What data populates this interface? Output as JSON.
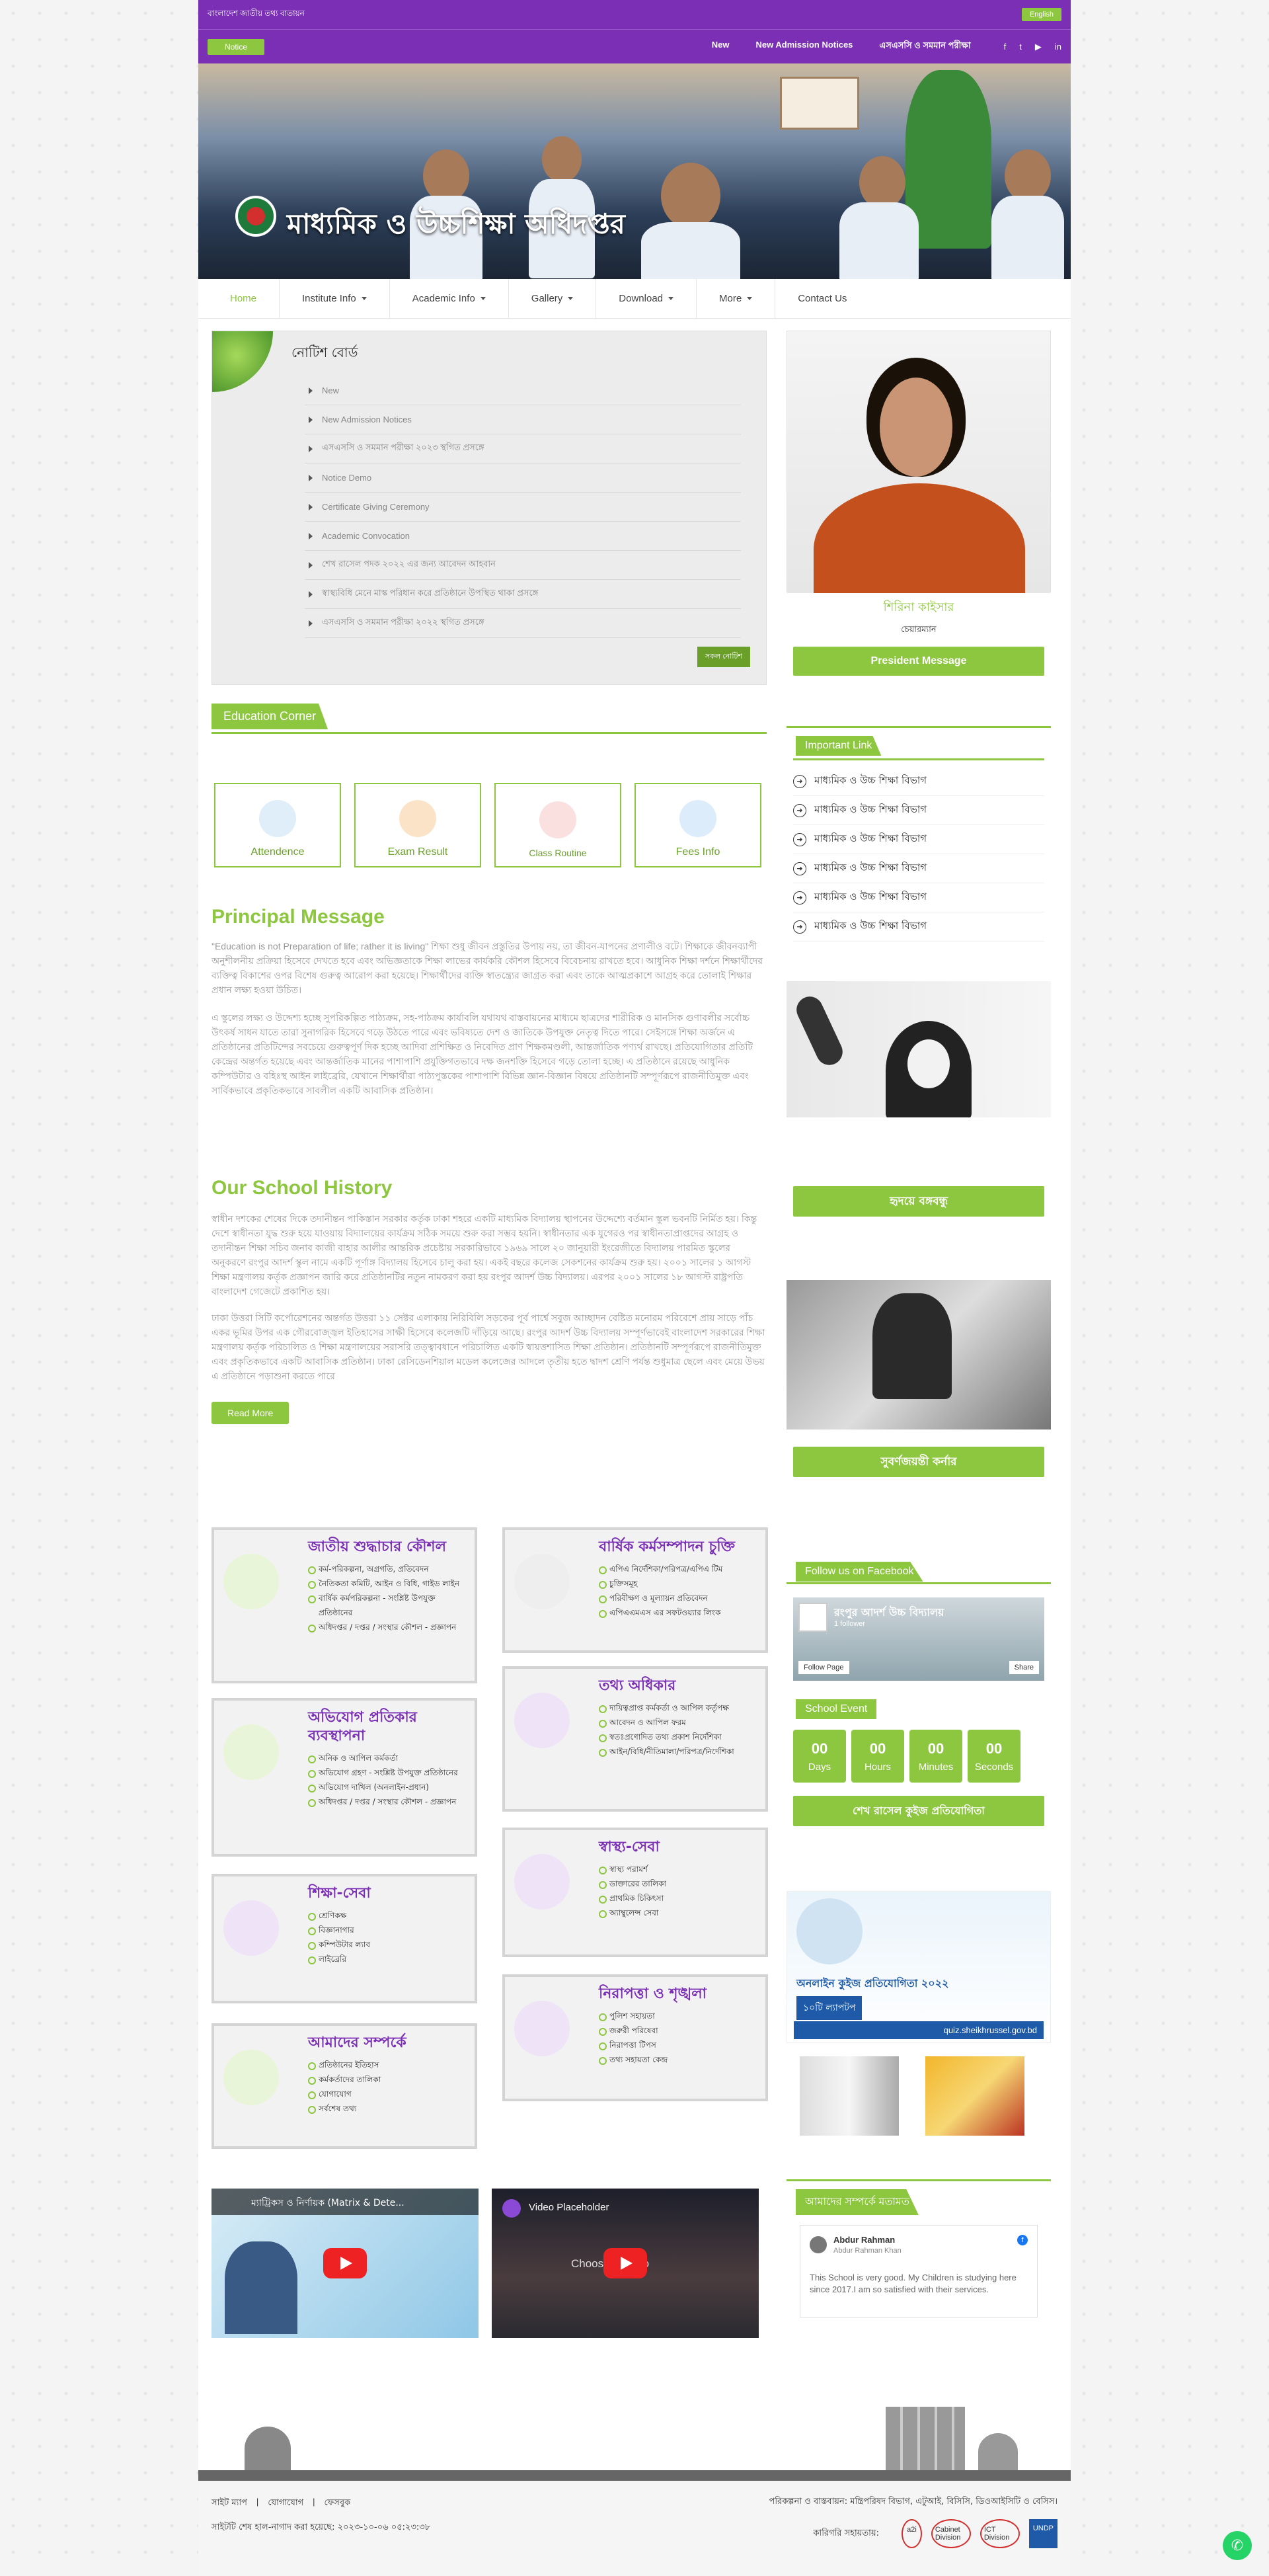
{
  "topbar": {
    "left_text": "বাংলাদেশ জাতীয় তথ্য বাতায়ন",
    "lang": "English"
  },
  "nav2": {
    "notice": "Notice",
    "links": [
      "New",
      "New Admission Notices",
      "এসএসসি ও সমমান পরীক্ষা"
    ]
  },
  "hero": {
    "title": "মাধ্যমিক ও উচ্চশিক্ষা অধিদপ্তর"
  },
  "menu": [
    "Home",
    "Institute Info",
    "Academic Info",
    "Gallery",
    "Download",
    "More",
    "Contact Us"
  ],
  "notice_board": {
    "title": "নোটিশ বোর্ড",
    "items": [
      "New",
      "New Admission Notices",
      "এসএসসি ও সমমান পরীক্ষা ২০২৩ স্থগিত প্রসঙ্গে",
      "Notice Demo",
      "Certificate Giving Ceremony",
      "Academic Convocation",
      "শেখ রাসেল পদক ২০২২ এর জন্য আবেদন আহবান",
      "স্বাস্থ্যবিধি মেনে মাস্ক পরিধান করে প্রতিষ্ঠানে উপস্থিত থাকা প্রসঙ্গে",
      "এসএসসি ও সমমান পরীক্ষা ২০২২ স্থগিত প্রসঙ্গে"
    ],
    "all_btn": "সকল নোটিশ"
  },
  "edu": {
    "title": "Education Corner",
    "cards": [
      "Attendence",
      "Exam Result",
      "Class Routine",
      "Fees Info"
    ]
  },
  "principal": {
    "title": "Principal Message",
    "p1": "\"Education is not Preparation of life; rather it is living\" শিক্ষা শুধু জীবন প্রস্তুতির উপায় নয়, তা জীবন-যাপনের প্রণালীও বটে। শিক্ষাকে জীবনব্যাপী অনুশীলনীয় প্রক্রিয়া হিসেবে দেখতে হবে এবং অভিজ্ঞতাকে শিক্ষা লাভের কার্যকরি কৌশল হিসেবে বিবেচনায় রাখতে হবে। আধুনিক শিক্ষা দর্শনে শিক্ষার্থীদের ব্যক্তিত্ব বিকাশের ওপর বিশেষ গুরুত্ব আরোপ করা হয়েছে। শিক্ষার্থীদের ব্যক্তি স্বাতন্ত্র্যের জাগ্রত করা এবং তাকে আত্মপ্রকাশে আগ্রহ করে তোলাই শিক্ষার প্রধান লক্ষ্য হওয়া উচিত।",
    "p2": "এ স্কুলের লক্ষ্য ও উদ্দেশ্য হচ্ছে সুপরিকল্পিত পাঠ্যক্রম, সহ-পাঠক্রম কার্যাবলি যথাযথ বাস্তবায়নের মাধ্যমে ছাত্রদের শারীরিক ও মানসিক গুণাবলীর সর্বোচ্চ উৎকর্ষ সাধন যাতে তারা সুনাগরিক হিসেবে গড়ে উঠতে পারে এবং ভবিষ্যতে দেশ ও জাতিকে উপযুক্ত নেতৃত্ব দিতে পারে। সেইসঙ্গে শিক্ষা অর্জনে এ প্রতিষ্ঠানের প্রতিটিন্দের সবচেয়ে গুরুত্বপূর্ণ দিক হচ্ছে আদিবা প্রশিক্ষিত ও নিবেদিত প্রাণ শিক্ষকমণ্ডলী, আন্তর্জাতিক পণ্যর্থ রাখছে। প্রতিযোগিতার প্রতিটি কেন্দ্রের অন্তর্গত হয়েছে এবং আন্তর্জাতিক মানের পাশাপাশি প্রযুক্তিগতভাবে দক্ষ জনশক্তি হিসেবে গড়ে তোলা হচ্ছে। এ প্রতিষ্ঠানে রয়েছে আধুনিক কম্পিউটার ও বহিঃস্থ আইন লাইব্রেরি, যেখানে শিক্ষার্থীরা পাঠ্যপুস্তকের পাশাপাশি বিভিন্ন জ্ঞান-বিজ্ঞান বিষয়ে প্রতিষ্ঠানটি সম্পূর্ণরূপে রাজনীতিমুক্ত এবং সার্বিকভাবে প্রকৃতিকভাবে সাবলীল একটি আবাসিক প্রতিষ্ঠান।"
  },
  "history": {
    "title": "Our School History",
    "p1": "স্বাধীন দশকের শেষের দিকে তদানীন্তন পাকিস্তান সরকার কর্তৃক ঢাকা শহরে একটি মাধ্যমিক বিদ্যালয় স্থাপনের উদ্দেশ্যে বর্তমান স্কুল ভবনটি নির্মিত হয়। কিন্তু দেশে স্বাধীনতা যুদ্ধ শুরু হয়ে যাওয়ায় বিদ্যালয়ের কার্যক্রম সঠিক সময়ে শুরু করা সম্ভব হয়নি। স্বাধীনতার এক যুগেরও পর স্বাধীনতাপ্রাপ্তদের আগ্রহ ও তদানীন্তন শিক্ষা সচিব জনাব কাজী বাহার আলীর আন্তরিক প্রচেষ্টায় সরকারিভাবে ১৯৬৯ সালে ২০ জানুয়ারী ইংরেজীতে বিদ্যালয় পারমিত স্কুলের অনুকরণে রংপুর আদর্শ স্কুল নামে একটি পূর্ণাঙ্গ বিদ্যালয় হিসেবে চালু করা হয়। একই বছরে কলেজ সেকশনের কার্যক্রম শুরু হয়। ২০০১ সালের ১ আগস্ট শিক্ষা মন্ত্রণালয় কর্তৃক প্রজ্ঞাপন জারি করে প্রতিষ্ঠানটির নতুন নামকরণ করা হয় রংপুর আদর্শ উচ্চ বিদ্যালয়। এরপর ২০০১ সালের ১৮ আগস্ট রাষ্ট্রপতি বাংলাদেশ গেজেটে প্রকাশিত হয়।",
    "p2": "ঢাকা উত্তরা সিটি কর্পোরেশনের অন্তর্গত উত্তরা ১১ সেক্টর এলাকায় নিরিবিলি সড়কের পূর্ব পার্শ্বে সবুজ আচ্ছাদন বেষ্টিত মনোরম পরিবেশে প্রায় সাড়ে পাঁচ একর ভূমির উপর এক গৌরবোজ্জ্বল ইতিহাসের সাক্ষী হিসেবে কলেজটি দাঁড়িয়ে আছে। রংপুর আদর্শ উচ্চ বিদ্যালয় সম্পূর্ণভাবেই বাংলাদেশ সরকারের শিক্ষা মন্ত্রণালয় কর্তৃক পরিচালিত ও শিক্ষা মন্ত্রণালয়ের সরাসরি তত্ত্বাবধানে পরিচালিত একটি স্বায়ত্তশাসিত শিক্ষা প্রতিষ্ঠান। প্রতিষ্ঠানটি সম্পূর্ণরূপে রাজনীতিমুক্ত এবং প্রকৃতিকভাবে একটি আবাসিক প্রতিষ্ঠান। ঢাকা রেসিডেনশিয়াল মডেল কলেজের আদলে তৃতীয় হতে দ্বাদশ শ্রেণি পর্যন্ত শুধুমাত্র ছেলে এবং মেয়ে উভয় এ প্রতিষ্ঠানে পড়াশুনা করতে পারে",
    "btn": "Read More"
  },
  "services": [
    {
      "title": "জাতীয় শুদ্ধাচার কৌশল",
      "items": [
        "কর্ম-পরিকল্পনা, অগ্রগতি, প্রতিবেদন",
        "নৈতিকতা কমিটি, আইন ও বিধি, গাইড লাইন",
        "বার্ষিক কর্মপরিকল্পনা - সংশ্লিষ্ট উপযুক্ত প্রতিষ্ঠানের",
        "অধিদপ্তর / দপ্তর / সংস্থার কৌশল - প্রজ্ঞাপন"
      ]
    },
    {
      "title": "বার্ষিক কর্মসম্পাদন চুক্তি",
      "items": [
        "এপিএ নির্দেশিকা/পরিপত্র/এপিএ টিম",
        "চুক্তিসমূহ",
        "পরিবীক্ষণ ও মূল্যায়ন প্রতিবেদন",
        "এপিএএমএস এর সফটওয়্যার লিংক"
      ]
    },
    {
      "title": "অভিযোগ প্রতিকার ব্যবস্থাপনা",
      "items": [
        "অনিক ও আপিল কর্মকর্তা",
        "অভিযোগ গ্রহণ - সংশ্লিষ্ট উপযুক্ত প্রতিষ্ঠানের",
        "অভিযোগ দাখিল (অনলাইন-প্রধান)",
        "অধিদপ্তর / দপ্তর / সংস্থার কৌশল - প্রজ্ঞাপন"
      ]
    },
    {
      "title": "তথ্য অধিকার",
      "items": [
        "দায়িত্বপ্রাপ্ত কর্মকর্তা ও আপিল কর্তৃপক্ষ",
        "আবেদন ও আপিল ফরম",
        "স্বতঃপ্রণোদিত তথ্য প্রকাশ নির্দেশিকা",
        "আইন/বিধি/নীতিমালা/পরিপত্র/নির্দেশিকা"
      ]
    },
    {
      "title": "শিক্ষা-সেবা",
      "items": [
        "শ্রেণিকক্ষ",
        "বিজ্ঞানাগার",
        "কম্পিউটার ল্যাব",
        "লাইব্রেরি"
      ]
    },
    {
      "title": "স্বাস্থ্য-সেবা",
      "items": [
        "স্বাস্থ্য পরামর্শ",
        "ডাক্তারের তালিকা",
        "প্রাথমিক চিকিৎসা",
        "অ্যাম্বুলেন্স সেবা"
      ]
    },
    {
      "title": "আমাদের সম্পর্কে",
      "items": [
        "প্রতিষ্ঠানের ইতিহাস",
        "কর্মকর্তাদের তালিকা",
        "যোগাযোগ",
        "সর্বশেষ তথ্য"
      ]
    },
    {
      "title": "নিরাপত্তা ও শৃঙ্খলা",
      "items": [
        "পুলিশ সহায়তা",
        "জরুরী পরিষেবা",
        "নিরাপত্তা টিপস",
        "তথ্য সহায়তা কেন্দ্র"
      ]
    }
  ],
  "videos": [
    {
      "title": "ম্যাট্রিকস ও নির্ণায়ক (Matrix & Dete..."
    },
    {
      "title": "Video Placeholder",
      "sub": "Choose a video"
    }
  ],
  "president": {
    "name": "শিরিনা কাইসার",
    "role": "চেয়ারম্যান",
    "btn": "President Message"
  },
  "important": {
    "title": "Important Link",
    "items": [
      "মাধ্যমিক ও উচ্চ শিক্ষা বিভাগ",
      "মাধ্যমিক ও উচ্চ শিক্ষা বিভাগ",
      "মাধ্যমিক ও উচ্চ শিক্ষা বিভাগ",
      "মাধ্যমিক ও উচ্চ শিক্ষা বিভাগ",
      "মাধ্যমিক ও উচ্চ শিক্ষা বিভাগ",
      "মাধ্যমিক ও উচ্চ শিক্ষা বিভাগ"
    ]
  },
  "bangabandhu_btn": "হৃদয়ে বঙ্গবন্ধু",
  "jubilee_btn": "সুবর্ণজয়ন্তী কর্নার",
  "facebook": {
    "title": "Follow us on Facebook",
    "page": "রংপুর আদর্শ উচ্চ বিদ্যালয়",
    "followers": "1 follower",
    "follow": "Follow Page",
    "share": "Share"
  },
  "event": {
    "title": "School Event",
    "days": "00",
    "hours": "00",
    "minutes": "00",
    "seconds": "00",
    "l_days": "Days",
    "l_hours": "Hours",
    "l_minutes": "Minutes",
    "l_seconds": "Seconds"
  },
  "quiz": {
    "btn": "শেখ রাসেল কুইজ প্রতিযোগিতা",
    "url": "quiz.sheikhrussel.gov.bd",
    "banner": "অনলাইন কুইজ প্রতিযোগিতা ২০২২",
    "prize": "১০টি ল্যাপটপ"
  },
  "review": {
    "title": "আমাদের সম্পর্কে মতামত",
    "name": "Abdur Rahman",
    "sub": "Abdur Rahman Khan",
    "text": "This School is very good. My Children is studying here since 2017.I am so satisfied with their services."
  },
  "footer": {
    "links": [
      "সাইট ম্যাপ",
      "যোগাযোগ",
      "ফেসবুক"
    ],
    "updated": "সাইটটি শেষ হাল-নাগাদ করা হয়েছে: ২০২৩-১০-০৬ ০৫:২৩:৩৮",
    "right1": "পরিকল্পনা ও বাস্তবায়ন: মন্ত্রিপরিষদ বিভাগ, এটুআই, বিসিসি, ডিওআইসিটি ও বেসিস।",
    "right2": "কারিগরি সহায়তায়:",
    "logos": [
      "a2i",
      "Cabinet Division",
      "ICT Division",
      "UNDP"
    ]
  }
}
